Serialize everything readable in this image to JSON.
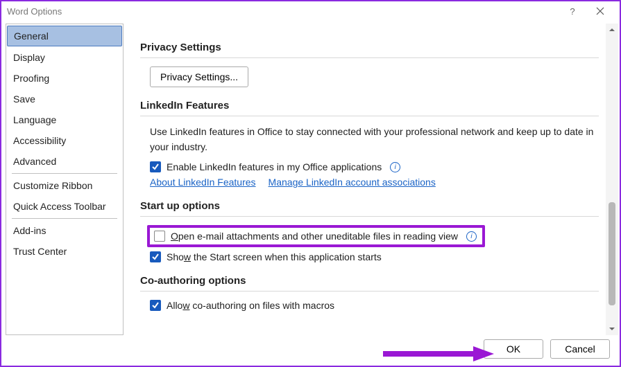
{
  "title": "Word Options",
  "sidebar": {
    "groups": [
      [
        "General",
        "Display",
        "Proofing",
        "Save",
        "Language",
        "Accessibility",
        "Advanced"
      ],
      [
        "Customize Ribbon",
        "Quick Access Toolbar"
      ],
      [
        "Add-ins",
        "Trust Center"
      ]
    ],
    "selected": "General"
  },
  "sections": {
    "privacy": {
      "heading": "Privacy Settings",
      "button": "Privacy Settings..."
    },
    "linkedin": {
      "heading": "LinkedIn Features",
      "blurb": "Use LinkedIn features in Office to stay connected with your professional network and keep up to date in your industry.",
      "checkbox_label_pre": "Enable LinkedIn features in my Office applications",
      "about_link": "About LinkedIn Features",
      "manage_link": "Manage LinkedIn account associations"
    },
    "startup": {
      "heading": "Start up options",
      "open_reading_pre": "O",
      "open_reading_post": "pen e-mail attachments and other uneditable files in reading view",
      "show_start_pre": "S",
      "show_start_mid": "ho",
      "show_start_accel": "w",
      "show_start_post": " the Start screen when this application starts"
    },
    "coauth": {
      "heading": "Co-authoring options",
      "macros_pre": "Allo",
      "macros_accel": "w",
      "macros_post": " co-authoring on files with macros"
    }
  },
  "buttons": {
    "ok": "OK",
    "cancel": "Cancel"
  },
  "checkboxes": {
    "linkedin_enabled": true,
    "open_reading": false,
    "show_start": true,
    "coauth_macros": true
  },
  "scroll": {
    "thumb_top_pct": 58,
    "thumb_height_pct": 36
  }
}
